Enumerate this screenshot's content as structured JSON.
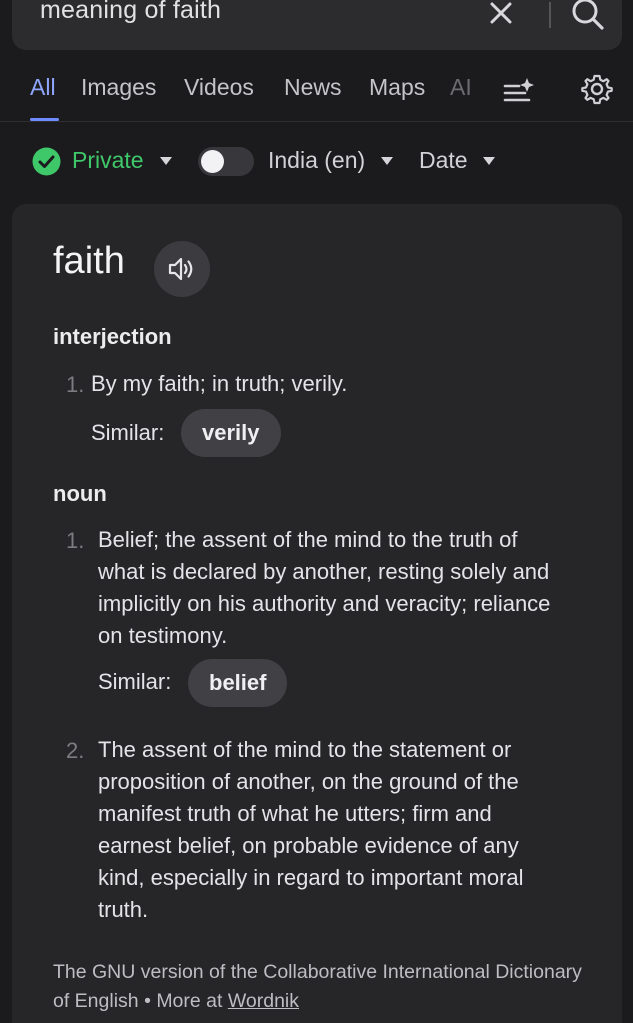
{
  "search": {
    "query": "meaning of faith"
  },
  "tabs": [
    {
      "label": "All",
      "active": true
    },
    {
      "label": "Images"
    },
    {
      "label": "Videos"
    },
    {
      "label": "News"
    },
    {
      "label": "Maps"
    },
    {
      "label": "AI"
    }
  ],
  "filters": {
    "private_label": "Private",
    "region_label": "India (en)",
    "date_label": "Date",
    "toggle_on": false
  },
  "definition": {
    "word": "faith",
    "sections": [
      {
        "pos": "interjection",
        "defs": [
          {
            "num": "1.",
            "text": "By my faith; in truth; verily.",
            "similar_label": "Similar:",
            "similar": "verily"
          }
        ]
      },
      {
        "pos": "noun",
        "defs": [
          {
            "num": "1.",
            "text": "Belief; the assent of the mind to the truth of what is declared by another, resting solely and implicitly on his authority and veracity; reliance on testimony.",
            "similar_label": "Similar:",
            "similar": "belief"
          },
          {
            "num": "2.",
            "text": "The assent of the mind to the statement or proposition of another, on the ground of the manifest truth of what he utters; firm and earnest belief, on probable evidence of any kind, especially in regard to important moral truth."
          }
        ]
      }
    ],
    "source_text": "The GNU version of the Collaborative International Dictionary of English",
    "more_at_label": "More at",
    "more_at_link": "Wordnik"
  },
  "colors": {
    "accent": "#8fa6ff",
    "private_green": "#3fc86a",
    "background": "#1b1b1d",
    "card": "#262628"
  }
}
